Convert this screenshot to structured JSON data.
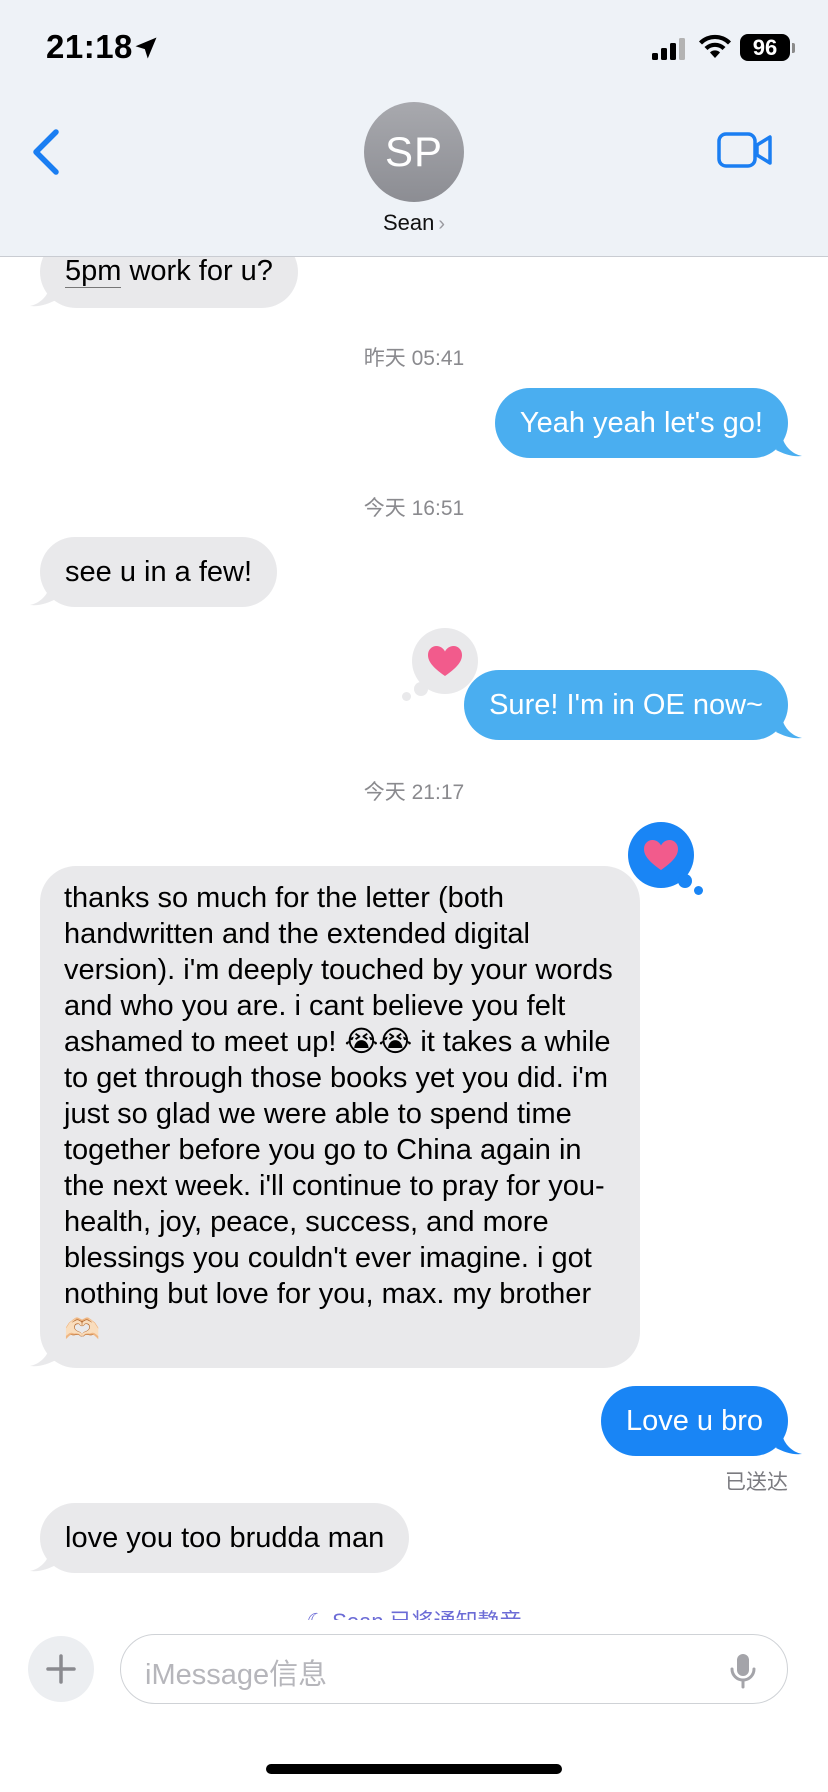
{
  "status_bar": {
    "time": "21:18",
    "battery": "96",
    "location_icon": "location-arrow-icon",
    "signal_icon": "cellular-signal-icon",
    "wifi_icon": "wifi-icon"
  },
  "header": {
    "avatar_initials": "SP",
    "contact_name": "Sean",
    "back_icon": "chevron-left-icon",
    "video_icon": "video-camera-icon",
    "accent_color": "#1a7ef2"
  },
  "messages": [
    {
      "type": "incoming",
      "text_underlined": "5pm",
      "text_rest": " work for u?"
    },
    {
      "type": "timestamp",
      "text": "昨天 05:41"
    },
    {
      "type": "outgoing",
      "text": "Yeah yeah let's go!"
    },
    {
      "type": "timestamp",
      "text": "今天 16:51"
    },
    {
      "type": "incoming",
      "text": "see u in a few!"
    },
    {
      "type": "outgoing",
      "text": "Sure! I'm in OE now~",
      "reaction": "heart"
    },
    {
      "type": "timestamp",
      "text": "今天 21:17"
    },
    {
      "type": "incoming",
      "text": "thanks so much for the letter (both handwritten and the extended digital version). i'm deeply touched by your words and who you are. i cant believe you felt ashamed to meet up! 😭😭 it takes a while to get through those books yet you did. i'm just so glad we were able to spend time together before you go to China again in the next week. i'll continue to pray for you- health, joy, peace, success, and more blessings you couldn't ever imagine. i got nothing but love for you, max. my brother 🫶🏻",
      "reaction": "heart"
    },
    {
      "type": "outgoing",
      "text": "Love u bro",
      "status": "已送达"
    },
    {
      "type": "incoming",
      "text": "love you too brudda man"
    }
  ],
  "muted_notice": "Sean 已将通知静音",
  "compose": {
    "placeholder": "iMessage信息",
    "plus_icon": "plus-icon",
    "mic_icon": "microphone-icon"
  },
  "colors": {
    "incoming_bubble": "#e9e9eb",
    "outgoing_bubble": "#4aaef0",
    "outgoing_bubble_latest": "#1985f5",
    "heart": "#f25b8c"
  }
}
